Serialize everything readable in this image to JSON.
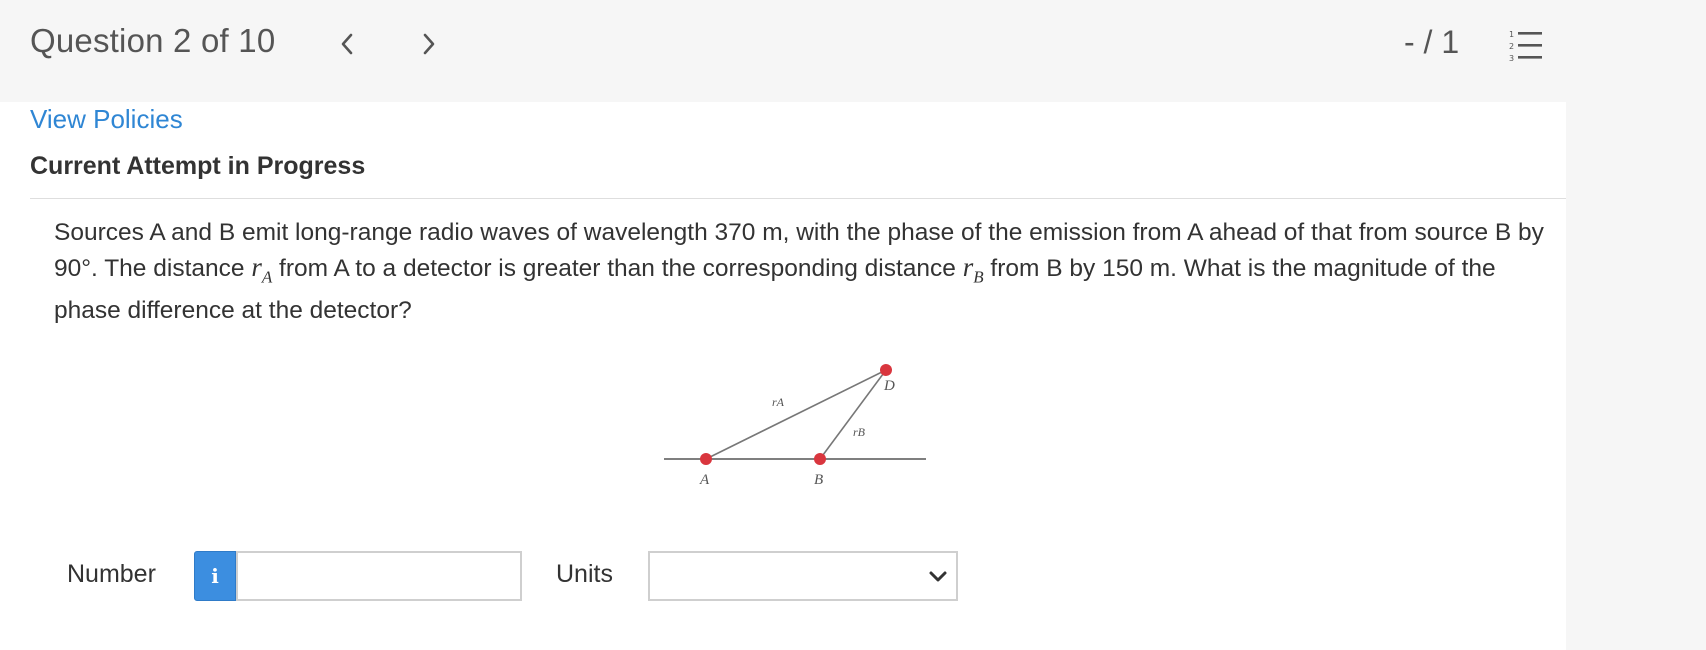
{
  "header": {
    "question_counter": "Question 2 of 10",
    "score": "- / 1",
    "prev_icon": "chevron-left-icon",
    "next_icon": "chevron-right-icon",
    "list_icon": "numbered-list-icon"
  },
  "links": {
    "view_policies": "View Policies"
  },
  "attempt_status": "Current Attempt in Progress",
  "question": {
    "part1": "Sources A and B emit long-range radio waves of wavelength 370 m, with the phase of the emission from A ahead of that from source B by 90°. The distance ",
    "var_a": "r",
    "sub_a": "A",
    "part2": " from A to a detector is greater than the corresponding distance ",
    "var_b": "r",
    "sub_b": "B",
    "part3": " from B by 150 m. What is the magnitude of the phase difference at the detector?"
  },
  "figure": {
    "label_a": "A",
    "label_b": "B",
    "label_d": "D",
    "label_ra": "rA",
    "label_rb": "rB",
    "point_color": "#d9363e",
    "line_color": "#777777"
  },
  "answer": {
    "number_label": "Number",
    "number_value": "",
    "info_icon": "info-icon",
    "units_label": "Units",
    "units_value": ""
  },
  "colors": {
    "link": "#2f86d4",
    "info_button": "#3c8ee0"
  }
}
